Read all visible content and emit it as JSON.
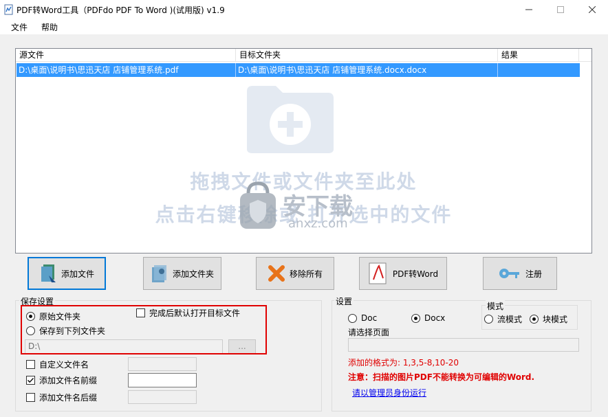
{
  "window": {
    "title": "PDF转Word工具（PDFdo PDF To Word )(试用版) v1.9"
  },
  "menu": {
    "file": "文件",
    "help": "帮助"
  },
  "list": {
    "columns": [
      "源文件",
      "目标文件夹",
      "结果"
    ],
    "rows": [
      {
        "source": "D:\\桌面\\说明书\\思迅天店 店铺管理系统.pdf",
        "target": "D:\\桌面\\说明书\\思迅天店 店铺管理系统.docx.docx",
        "result": ""
      }
    ],
    "hint_line1": "拖拽文件或文件夹至此处",
    "hint_line2": "点击右键移除或 打开选中的文件"
  },
  "watermark": {
    "main": "安下载",
    "sub": "anxz.com"
  },
  "toolbar": {
    "add_file": "添加文件",
    "add_folder": "添加文件夹",
    "remove_all": "移除所有",
    "convert": "PDF转Word",
    "register": "注册"
  },
  "save_settings": {
    "title": "保存设置",
    "original_folder": "原始文件夹",
    "save_to_folder": "保存到下列文件夹",
    "open_after": "完成后默认打开目标文件",
    "folder_path": "D:\\",
    "browse": "...",
    "custom_name": "自定义文件名",
    "add_prefix": "添加文件名前缀",
    "add_suffix": "添加文件名后缀"
  },
  "settings": {
    "title": "设置",
    "doc": "Doc",
    "docx": "Docx",
    "mode_title": "模式",
    "flow_mode": "流模式",
    "block_mode": "块模式",
    "select_pages": "请选择页面",
    "format_hint": "添加的格式为: 1,3,5-8,10-20",
    "note": "注意：扫描的图片PDF不能转换为可编辑的Word.",
    "run_as_admin": "请以管理员身份运行"
  },
  "colors": {
    "selection": "#3399ff",
    "highlight_box": "#e00000",
    "note": "#e00000"
  }
}
